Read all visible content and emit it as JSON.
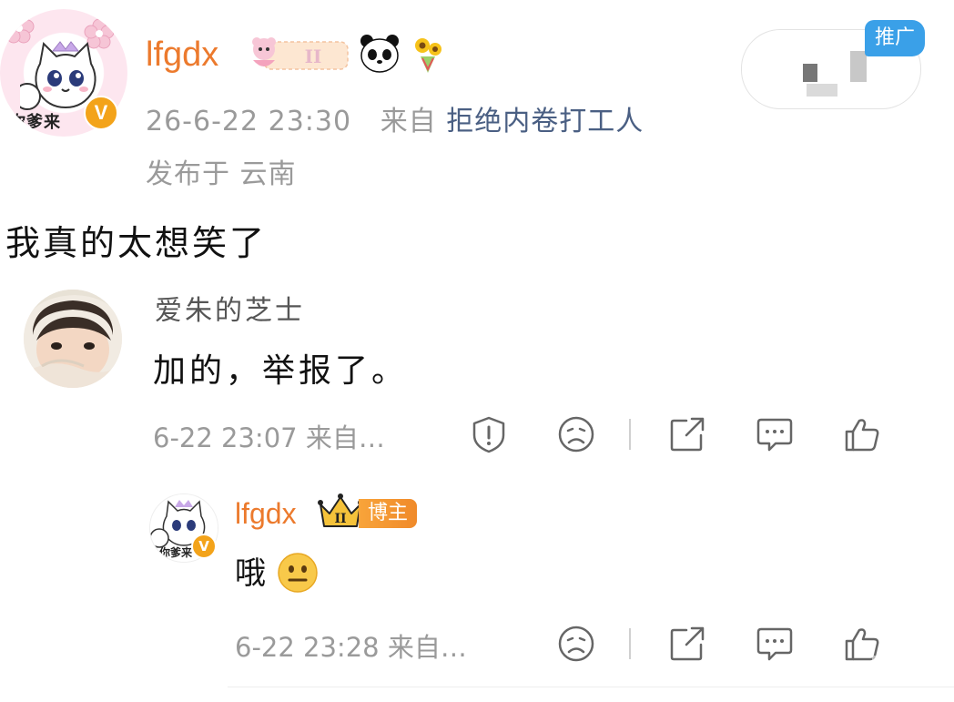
{
  "post": {
    "author": "lfgdx",
    "avatar_text": "你爹来",
    "verified_mark": "V",
    "level_badge_numeral": "II",
    "timestamp": "26-6-22 23:30",
    "source_prefix": "来自",
    "source_name": "拒绝内卷打工人",
    "location": "发布于 云南",
    "body": "我真的太想笑了",
    "promo_tag": "推广"
  },
  "comment": {
    "user": "爱朱的芝士",
    "text": "加的，举报了。",
    "time": "6-22 23:07",
    "source": "来自…",
    "actions": [
      "report-icon",
      "dislike-icon",
      "share-icon",
      "comment-icon",
      "like-icon"
    ]
  },
  "reply": {
    "user": "lfgdx",
    "badge_numeral": "II",
    "role_badge": "博主",
    "text": "哦",
    "emoji": "neutral-face",
    "time": "6-22 23:28",
    "source": "来自…",
    "avatar_text": "你爹来",
    "verified_mark": "V",
    "actions": [
      "dislike-icon",
      "share-icon",
      "comment-icon",
      "like-icon"
    ]
  },
  "colors": {
    "username": "#ec7a2d",
    "meta": "#9a9a9a",
    "source_link": "#4a5f83",
    "verified": "#f3a31a",
    "promo": "#3aa0e8"
  }
}
